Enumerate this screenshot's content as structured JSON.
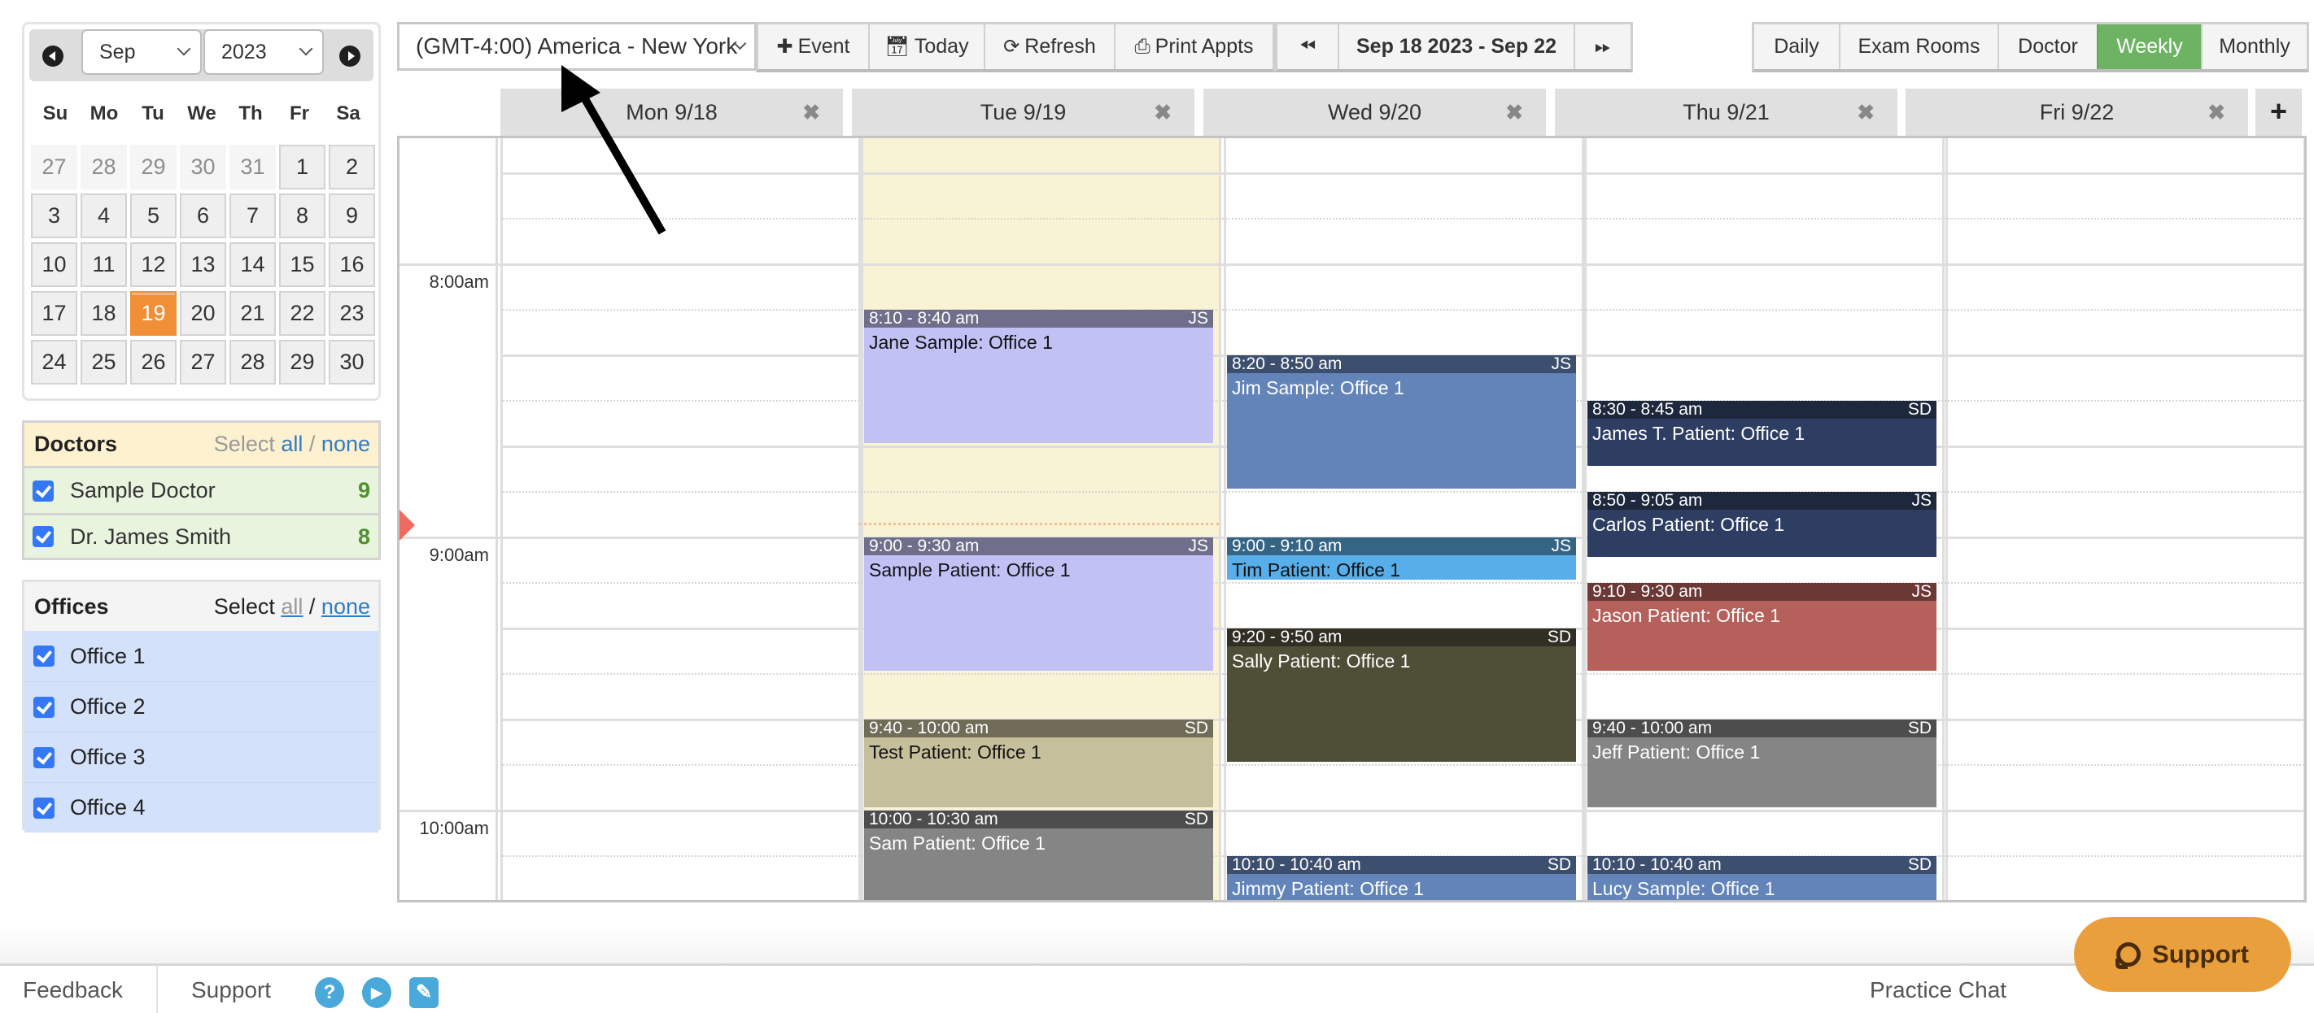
{
  "mini_calendar": {
    "prev_label": "Previous month",
    "next_label": "Next month",
    "month": "Sep",
    "year": "2023",
    "weekdays": [
      "Su",
      "Mo",
      "Tu",
      "We",
      "Th",
      "Fr",
      "Sa"
    ],
    "weeks": [
      [
        {
          "d": "27",
          "other": true
        },
        {
          "d": "28",
          "other": true
        },
        {
          "d": "29",
          "other": true
        },
        {
          "d": "30",
          "other": true
        },
        {
          "d": "31",
          "other": true
        },
        {
          "d": "1"
        },
        {
          "d": "2"
        }
      ],
      [
        {
          "d": "3"
        },
        {
          "d": "4"
        },
        {
          "d": "5"
        },
        {
          "d": "6"
        },
        {
          "d": "7"
        },
        {
          "d": "8"
        },
        {
          "d": "9"
        }
      ],
      [
        {
          "d": "10"
        },
        {
          "d": "11"
        },
        {
          "d": "12"
        },
        {
          "d": "13"
        },
        {
          "d": "14"
        },
        {
          "d": "15"
        },
        {
          "d": "16"
        }
      ],
      [
        {
          "d": "17"
        },
        {
          "d": "18"
        },
        {
          "d": "19",
          "today": true
        },
        {
          "d": "20"
        },
        {
          "d": "21"
        },
        {
          "d": "22"
        },
        {
          "d": "23"
        }
      ],
      [
        {
          "d": "24"
        },
        {
          "d": "25"
        },
        {
          "d": "26"
        },
        {
          "d": "27"
        },
        {
          "d": "28"
        },
        {
          "d": "29"
        },
        {
          "d": "30"
        }
      ]
    ]
  },
  "doctors": {
    "title": "Doctors",
    "select_label": "Select",
    "all_label": "all",
    "sep": "/",
    "none_label": "none",
    "items": [
      {
        "name": "Sample Doctor",
        "count": "9",
        "checked": true
      },
      {
        "name": "Dr. James Smith",
        "count": "8",
        "checked": true
      }
    ]
  },
  "offices": {
    "title": "Offices",
    "select_label": "Select",
    "all_label": "all",
    "sep": "/",
    "none_label": "none",
    "items": [
      {
        "name": "Office 1",
        "checked": true
      },
      {
        "name": "Office 2",
        "checked": true
      },
      {
        "name": "Office 3",
        "checked": true
      },
      {
        "name": "Office 4",
        "checked": true
      }
    ]
  },
  "toolbar": {
    "timezone": "(GMT-4:00) America - New York",
    "event_label": "Event",
    "today_label": "Today",
    "refresh_label": "Refresh",
    "print_label": "Print Appts",
    "date_range": "Sep 18 2023 - Sep 22",
    "views": [
      {
        "label": "Daily",
        "active": false
      },
      {
        "label": "Exam Rooms",
        "active": false
      },
      {
        "label": "Doctor",
        "active": false
      },
      {
        "label": "Weekly",
        "active": true
      },
      {
        "label": "Monthly",
        "active": false
      }
    ]
  },
  "calendar": {
    "days": [
      {
        "label": "Mon 9/18",
        "highlight": false
      },
      {
        "label": "Tue 9/19",
        "highlight": true
      },
      {
        "label": "Wed 9/20",
        "highlight": false
      },
      {
        "label": "Thu 9/21",
        "highlight": false
      },
      {
        "label": "Fri 9/22",
        "highlight": false
      }
    ],
    "close_glyph": "✖",
    "add_glyph": "+",
    "time_labels": [
      {
        "label": "8:00am",
        "minutes": 480
      },
      {
        "label": "9:00am",
        "minutes": 540
      },
      {
        "label": "10:00am",
        "minutes": 600
      }
    ],
    "start_minutes": 452.5,
    "end_minutes": 621,
    "now_minutes": 537,
    "events": [
      {
        "day": 1,
        "start": 490,
        "end": 520,
        "time": "8:10 - 8:40 am",
        "initials": "JS",
        "title": "Jane Sample: Office 1",
        "head": "#6f6f8c",
        "body": "#c2c1f5",
        "text": "#111111"
      },
      {
        "day": 1,
        "start": 540,
        "end": 570,
        "time": "9:00 - 9:30 am",
        "initials": "JS",
        "title": "Sample Patient: Office 1",
        "head": "#6f6f8c",
        "body": "#c2c1f5",
        "text": "#111111"
      },
      {
        "day": 1,
        "start": 580,
        "end": 600,
        "time": "9:40 - 10:00 am",
        "initials": "SD",
        "title": "Test Patient: Office 1",
        "head": "#706c58",
        "body": "#c5bf9c",
        "text": "#111111"
      },
      {
        "day": 1,
        "start": 600,
        "end": 630,
        "time": "10:00 - 10:30 am",
        "initials": "SD",
        "title": "Sam Patient: Office 1",
        "head": "#4d4d4d",
        "body": "#858585",
        "text": "#ffffff"
      },
      {
        "day": 2,
        "start": 500,
        "end": 530,
        "time": "8:20 - 8:50 am",
        "initials": "JS",
        "title": "Jim Sample: Office 1",
        "head": "#3d4f6e",
        "body": "#6284b9",
        "text": "#ffffff"
      },
      {
        "day": 2,
        "start": 540,
        "end": 550,
        "time": "9:00 - 9:10 am",
        "initials": "JS",
        "title": "Tim Patient: Office 1",
        "head": "#356584",
        "body": "#57aee8",
        "text": "#111111"
      },
      {
        "day": 2,
        "start": 560,
        "end": 590,
        "time": "9:20 - 9:50 am",
        "initials": "SD",
        "title": "Sally Patient: Office 1",
        "head": "#312f24",
        "body": "#4f4e37",
        "text": "#ffffff"
      },
      {
        "day": 2,
        "start": 610,
        "end": 640,
        "time": "10:10 - 10:40 am",
        "initials": "SD",
        "title": "Jimmy Patient: Office 1",
        "head": "#3d4f6e",
        "body": "#6284b9",
        "text": "#ffffff"
      },
      {
        "day": 3,
        "start": 510,
        "end": 525,
        "time": "8:30 - 8:45 am",
        "initials": "SD",
        "title": "James T. Patient: Office 1",
        "head": "#1e283c",
        "body": "#2d3e62",
        "text": "#ffffff"
      },
      {
        "day": 3,
        "start": 530,
        "end": 545,
        "time": "8:50 - 9:05 am",
        "initials": "JS",
        "title": "Carlos Patient: Office 1",
        "head": "#1e283c",
        "body": "#2d3e62",
        "text": "#ffffff"
      },
      {
        "day": 3,
        "start": 550,
        "end": 570,
        "time": "9:10 - 9:30 am",
        "initials": "JS",
        "title": "Jason Patient: Office 1",
        "head": "#6b3836",
        "body": "#b5605b",
        "text": "#ffffff"
      },
      {
        "day": 3,
        "start": 580,
        "end": 600,
        "time": "9:40 - 10:00 am",
        "initials": "SD",
        "title": "Jeff Patient: Office 1",
        "head": "#4d4d4d",
        "body": "#858585",
        "text": "#ffffff"
      },
      {
        "day": 3,
        "start": 610,
        "end": 640,
        "time": "10:10 - 10:40 am",
        "initials": "SD",
        "title": "Lucy Sample: Office 1",
        "head": "#3d4f6e",
        "body": "#6284b9",
        "text": "#ffffff"
      }
    ]
  },
  "footer": {
    "feedback_label": "Feedback",
    "support_label": "Support",
    "help_glyph": "?",
    "play_glyph": "▶",
    "edit_glyph": "✎",
    "practice_chat_label": "Practice Chat",
    "support_button_label": "Support"
  }
}
